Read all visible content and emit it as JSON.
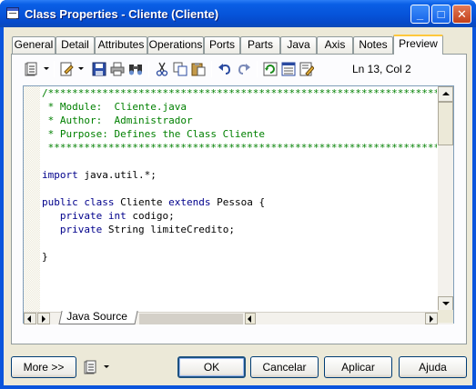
{
  "window": {
    "title": "Class Properties - Cliente (Cliente)",
    "controls": {
      "minimize": "_",
      "maximize": "□",
      "close": "✕"
    }
  },
  "tabs": [
    {
      "label": "General"
    },
    {
      "label": "Detail"
    },
    {
      "label": "Attributes"
    },
    {
      "label": "Operations"
    },
    {
      "label": "Ports"
    },
    {
      "label": "Parts"
    },
    {
      "label": "Java"
    },
    {
      "label": "Axis"
    },
    {
      "label": "Notes"
    },
    {
      "label": "Preview",
      "active": true
    }
  ],
  "toolbar": {
    "icons": [
      "template-icon",
      "edit-icon",
      "save-icon",
      "print-icon",
      "find-icon",
      "cut-icon",
      "copy-icon",
      "paste-icon",
      "undo-icon",
      "redo-icon",
      "refresh-icon",
      "generate-icon",
      "edit-text-icon"
    ],
    "position": "Ln 13, Col 2"
  },
  "editor": {
    "lines": [
      "/***********************************************************************",
      " * Module:  Cliente.java",
      " * Author:  Administrador",
      " * Purpose: Defines the Class Cliente",
      " ***********************************************************************/",
      "",
      "import java.util.*;",
      "",
      "public class Cliente extends Pessoa {",
      "   private int codigo;",
      "   private String limiteCredito;",
      "",
      "}"
    ],
    "source_tab": "Java Source"
  },
  "buttons": {
    "more": "More >>",
    "ok": "OK",
    "cancel": "Cancelar",
    "apply": "Aplicar",
    "help": "Ajuda"
  },
  "colors": {
    "titlebar": "#0a55dd",
    "comment": "#008000",
    "keyword": "#00008b",
    "active_tab_accent": "#ffc83c"
  }
}
